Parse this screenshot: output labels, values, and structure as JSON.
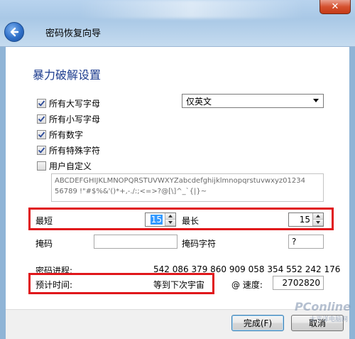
{
  "window": {
    "title": "密码恢复向导",
    "close_label": "✕"
  },
  "page": {
    "heading": "暴力破解设置"
  },
  "charset_options": [
    {
      "label": "所有大写字母",
      "checked": true
    },
    {
      "label": "所有小写字母",
      "checked": true
    },
    {
      "label": "所有数字",
      "checked": true
    },
    {
      "label": "所有特殊字符",
      "checked": true
    },
    {
      "label": "用户自定义",
      "checked": false
    }
  ],
  "language_select": {
    "value": "仅英文"
  },
  "charset_preview": {
    "line1": "ABCDEFGHIJKLMNOPQRSTUVWXYZabcdefghijklmnopqrstuvwxyz01234",
    "line2": "56789 !\"#$%&'()*+,-./:;<=>?@[\\]^_`{|}~"
  },
  "length": {
    "min_label": "最短",
    "min_value": "15",
    "max_label": "最长",
    "max_value": "15"
  },
  "mask": {
    "label": "掩码",
    "value": "",
    "char_label": "掩码字符",
    "char_value": "?"
  },
  "progress": {
    "label": "密码进程:",
    "value": "542 086 379 860 909 058 354 552 242 176"
  },
  "estimate": {
    "label": "预计时间:",
    "value": "等到下次宇宙",
    "speed_label": "@ 速度:",
    "speed_value": "2702820"
  },
  "buttons": {
    "finish": "完成(F)",
    "cancel": "取消"
  },
  "watermark": {
    "brand": "PConline",
    "sub": "太平洋电脑网"
  },
  "colors": {
    "highlight": "#e0171b",
    "heading": "#1e3d8f"
  }
}
